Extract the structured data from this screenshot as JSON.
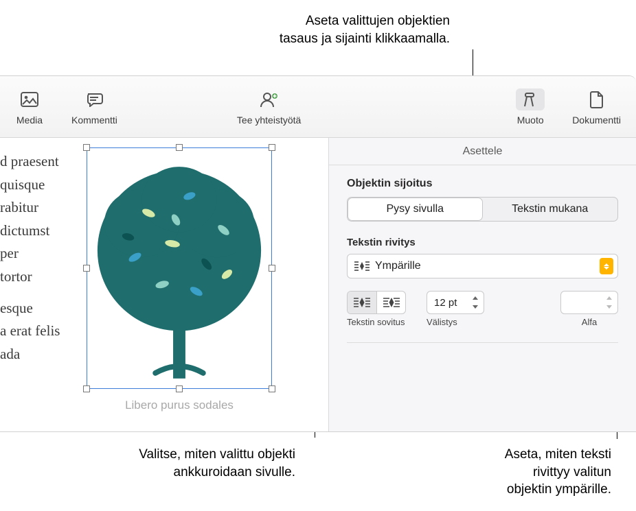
{
  "callouts": {
    "top": "Aseta valittujen objektien\ntasaus ja sijainti klikkaamalla.",
    "bottom_left": "Valitse, miten valittu objekti\nankkuroidaan sivulle.",
    "bottom_right": "Aseta, miten teksti\nrivittyy valitun\nobjektin ympärille."
  },
  "toolbar": {
    "media": "Media",
    "comment": "Kommentti",
    "collaborate": "Tee yhteistyötä",
    "format": "Muoto",
    "document": "Dokumentti"
  },
  "doc": {
    "lines1": [
      "d praesent",
      "quisque",
      "rabitur",
      "dictumst",
      "per",
      "tortor"
    ],
    "lines2": [
      "esque",
      "a erat felis",
      "ada"
    ],
    "caption": "Libero purus sodales"
  },
  "inspector": {
    "tab_arrange": "Asettele",
    "section_placement": "Objektin sijoitus",
    "seg_stay": "Pysy sivulla",
    "seg_with_text": "Tekstin mukana",
    "section_wrap": "Tekstin rivitys",
    "wrap_value": "Ympärille",
    "fit_label": "Tekstin sovitus",
    "spacing_label": "Välistys",
    "spacing_value": "12 pt",
    "alpha_label": "Alfa",
    "alpha_value": ""
  }
}
